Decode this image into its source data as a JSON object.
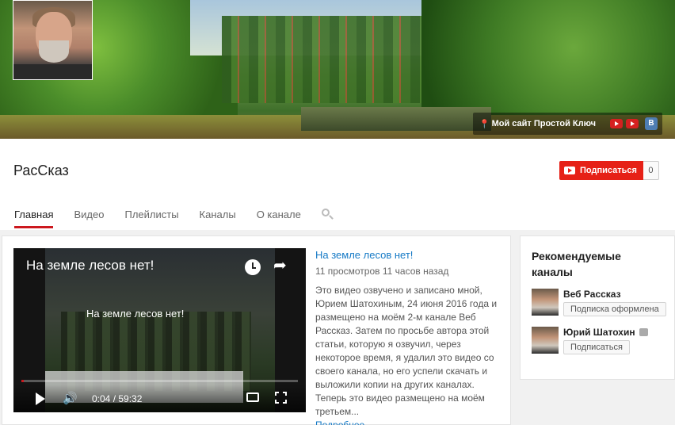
{
  "banner": {
    "site_link": "Мой сайт Простой Ключ",
    "vk_label": "В"
  },
  "channel": {
    "title": "РасСказ",
    "subscribe_label": "Подписаться",
    "subscriber_count": "0"
  },
  "tabs": [
    {
      "label": "Главная",
      "active": true
    },
    {
      "label": "Видео"
    },
    {
      "label": "Плейлисты"
    },
    {
      "label": "Каналы"
    },
    {
      "label": "О канале"
    }
  ],
  "player": {
    "overlay_title": "На земле лесов нет!",
    "inner_title": "На земле лесов нет!",
    "time": "0:04 / 59:32",
    "progress": 0.001
  },
  "video": {
    "title": "На земле лесов нет!",
    "meta": "11 просмотров  11 часов назад",
    "description": "Это видео озвучено и записано мной, Юрием Шатохиным, 24 июня 2016 года и размещено на моём 2-м канале Веб Рассказ. Затем по просьбе автора этой статьи, которую я озвучил, через некоторое время, я удалил это видео со своего канала, но его успели скачать и выложили копии на других каналах. Теперь это видео размещено на моём третьем...",
    "more": "Подробнее..."
  },
  "sidebar": {
    "title": "Рекомендуемые каналы",
    "channels": [
      {
        "name": "Веб Рассказ",
        "button": "Подписка оформлена"
      },
      {
        "name": "Юрий Шатохин",
        "button": "Подписаться"
      }
    ]
  }
}
